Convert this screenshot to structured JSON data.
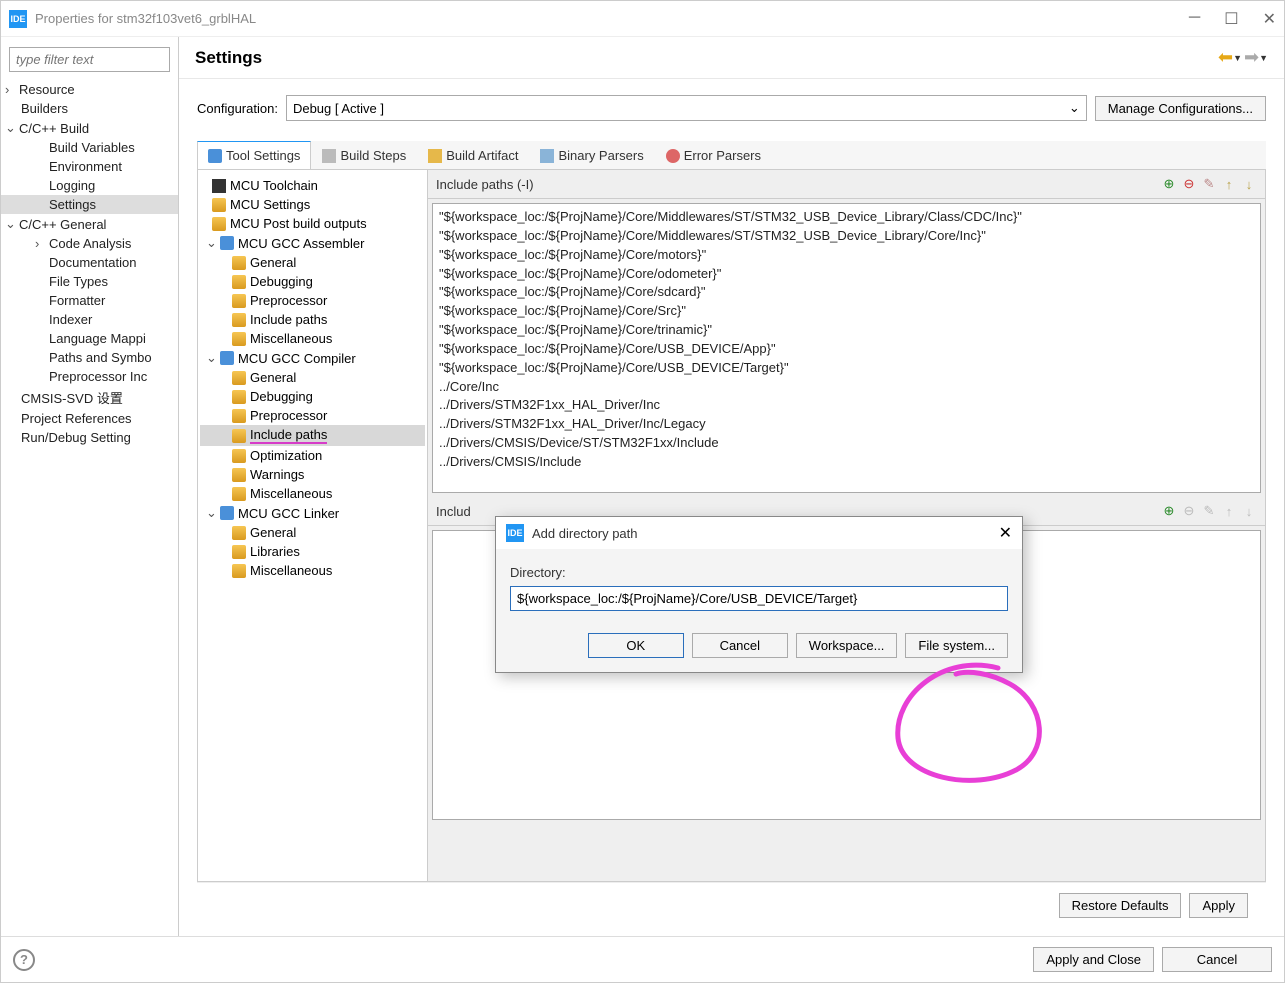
{
  "window": {
    "title": "Properties for stm32f103vet6_grblHAL"
  },
  "filter": {
    "placeholder": "type filter text"
  },
  "leftTree": {
    "resource": "Resource",
    "builders": "Builders",
    "ccbuild": "C/C++ Build",
    "buildvars": "Build Variables",
    "environment": "Environment",
    "logging": "Logging",
    "settings": "Settings",
    "ccgeneral": "C/C++ General",
    "codeanalysis": "Code Analysis",
    "documentation": "Documentation",
    "filetypes": "File Types",
    "formatter": "Formatter",
    "indexer": "Indexer",
    "langmap": "Language Mappi",
    "paths": "Paths and Symbo",
    "preproc": "Preprocessor Inc",
    "cmsis": "CMSIS-SVD 设置",
    "projrefs": "Project References",
    "rundebug": "Run/Debug Setting"
  },
  "header": {
    "title": "Settings"
  },
  "config": {
    "label": "Configuration:",
    "value": "Debug  [ Active ]",
    "manage": "Manage Configurations..."
  },
  "tabs": {
    "tool": "Tool Settings",
    "steps": "Build Steps",
    "artifact": "Build Artifact",
    "binary": "Binary Parsers",
    "error": "Error Parsers"
  },
  "toolTree": {
    "toolchain": "MCU Toolchain",
    "mcusettings": "MCU Settings",
    "postbuild": "MCU Post build outputs",
    "assembler": "MCU GCC Assembler",
    "general": "General",
    "debugging": "Debugging",
    "preprocessor": "Preprocessor",
    "includepaths": "Include paths",
    "misc": "Miscellaneous",
    "compiler": "MCU GCC Compiler",
    "optimization": "Optimization",
    "warnings": "Warnings",
    "linker": "MCU GCC Linker",
    "libraries": "Libraries"
  },
  "includes": {
    "header": "Include paths (-I)",
    "header2": "Includ",
    "paths": [
      "\"${workspace_loc:/${ProjName}/Core/Middlewares/ST/STM32_USB_Device_Library/Class/CDC/Inc}\"",
      "\"${workspace_loc:/${ProjName}/Core/Middlewares/ST/STM32_USB_Device_Library/Core/Inc}\"",
      "\"${workspace_loc:/${ProjName}/Core/motors}\"",
      "\"${workspace_loc:/${ProjName}/Core/odometer}\"",
      "\"${workspace_loc:/${ProjName}/Core/sdcard}\"",
      "\"${workspace_loc:/${ProjName}/Core/Src}\"",
      "\"${workspace_loc:/${ProjName}/Core/trinamic}\"",
      "\"${workspace_loc:/${ProjName}/Core/USB_DEVICE/App}\"",
      "\"${workspace_loc:/${ProjName}/Core/USB_DEVICE/Target}\"",
      "../Core/Inc",
      "../Drivers/STM32F1xx_HAL_Driver/Inc",
      "../Drivers/STM32F1xx_HAL_Driver/Inc/Legacy",
      "../Drivers/CMSIS/Device/ST/STM32F1xx/Include",
      "../Drivers/CMSIS/Include"
    ]
  },
  "dialog": {
    "title": "Add directory path",
    "label": "Directory:",
    "value": "${workspace_loc:/${ProjName}/Core/USB_DEVICE/Target}",
    "ok": "OK",
    "cancel": "Cancel",
    "workspace": "Workspace...",
    "filesystem": "File system..."
  },
  "buttons": {
    "restore": "Restore Defaults",
    "apply": "Apply",
    "applyclose": "Apply and Close",
    "cancel": "Cancel"
  }
}
